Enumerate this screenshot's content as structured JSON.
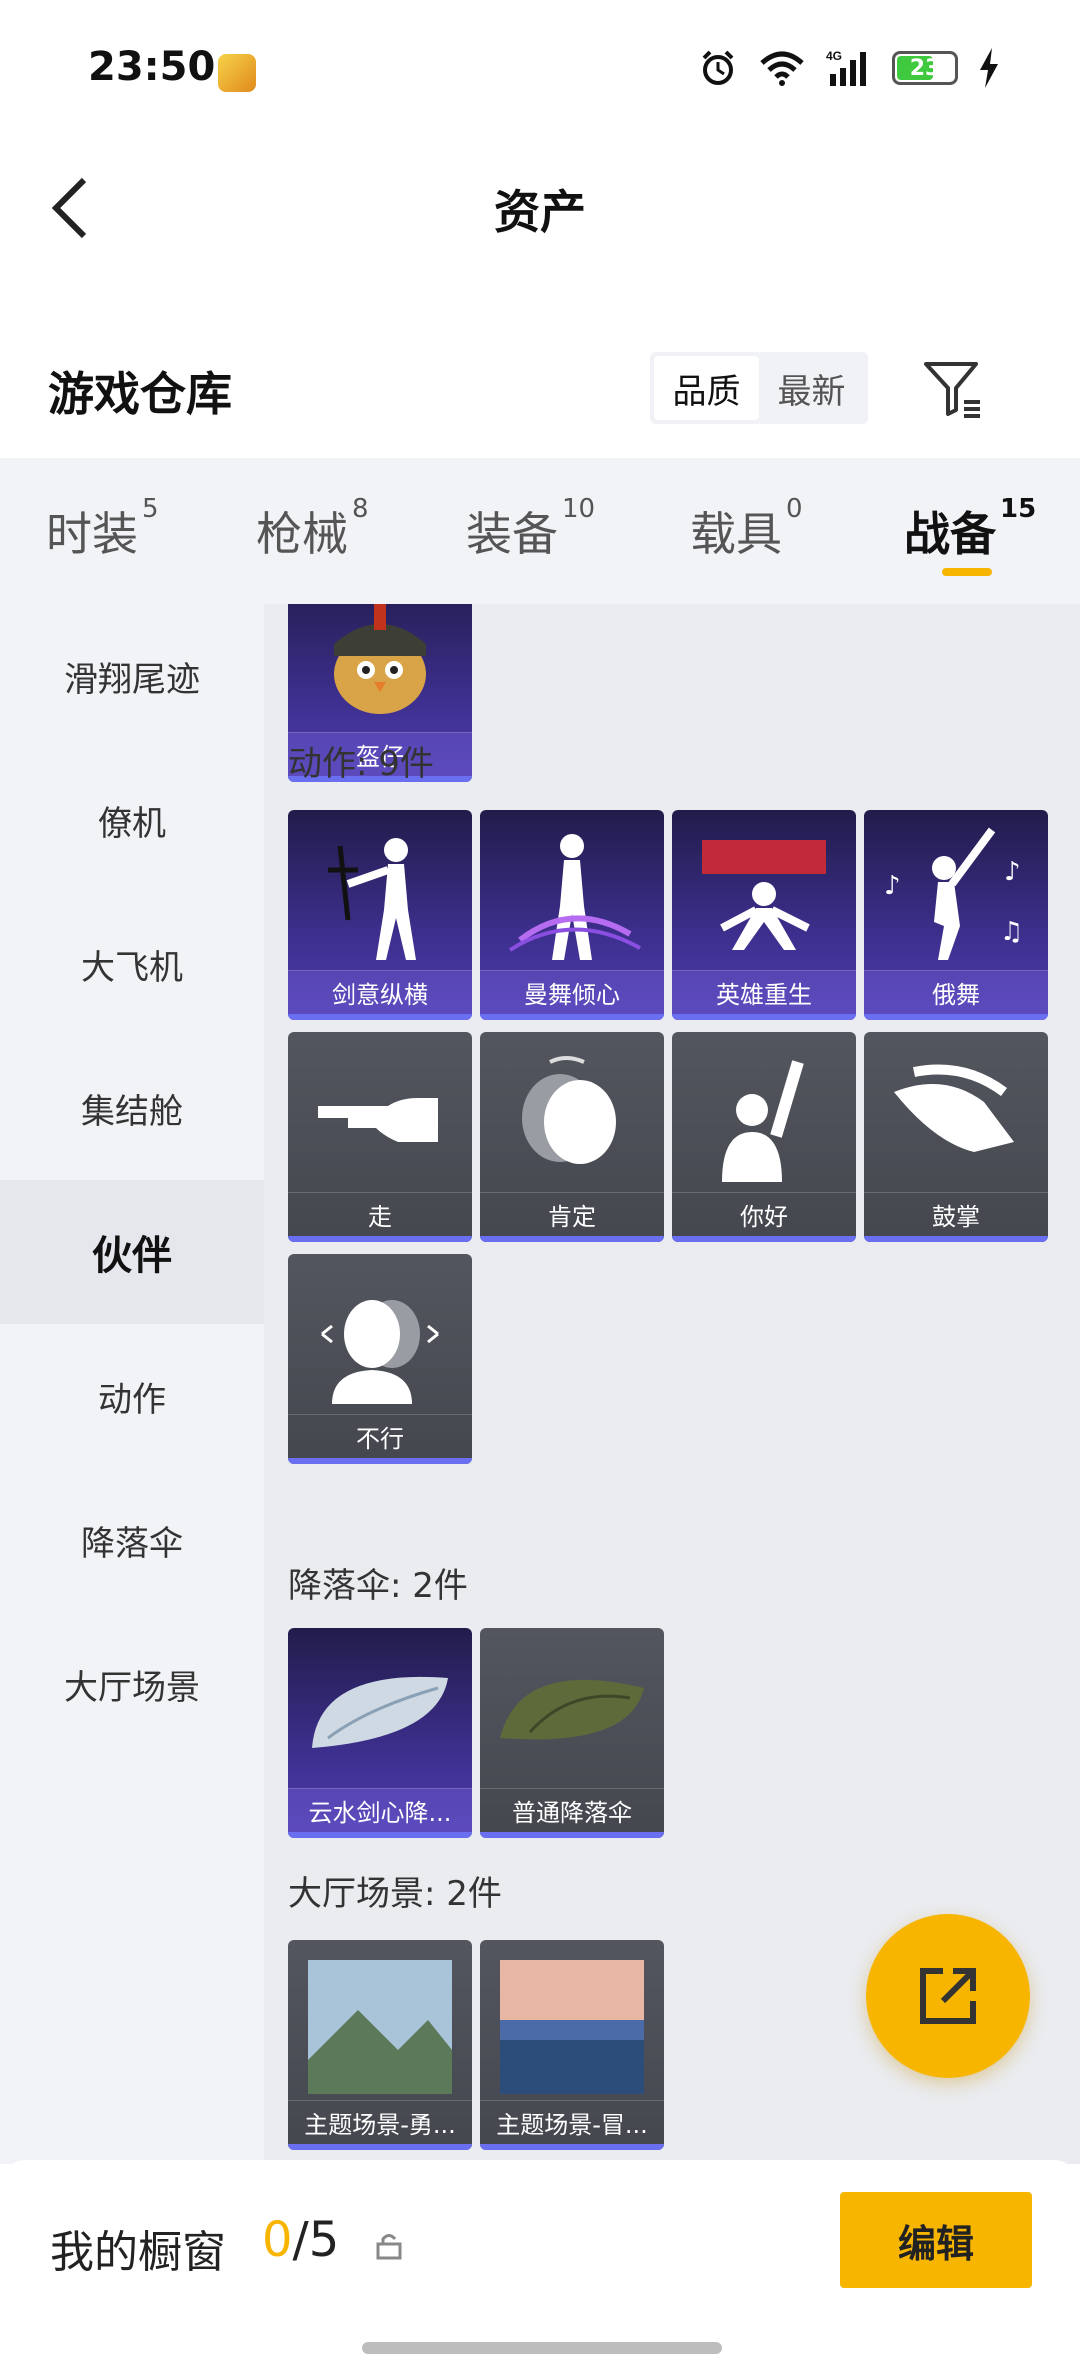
{
  "status_bar": {
    "time": "23:50",
    "battery": "23"
  },
  "header": {
    "title": "资产"
  },
  "warehouse": {
    "title": "游戏仓库",
    "sort_options": [
      {
        "label": "品质",
        "active": true
      },
      {
        "label": "最新",
        "active": false
      }
    ]
  },
  "tabs": [
    {
      "label": "时装",
      "count": "5"
    },
    {
      "label": "枪械",
      "count": "8"
    },
    {
      "label": "装备",
      "count": "10"
    },
    {
      "label": "载具",
      "count": "0"
    },
    {
      "label": "战备",
      "count": "15",
      "active": true
    }
  ],
  "sidebar": {
    "items": [
      {
        "label": "滑翔尾迹"
      },
      {
        "label": "僚机"
      },
      {
        "label": "大飞机"
      },
      {
        "label": "集结舱"
      },
      {
        "label": "伙伴",
        "active": true
      },
      {
        "label": "动作"
      },
      {
        "label": "降落伞"
      },
      {
        "label": "大厅场景"
      }
    ]
  },
  "content": {
    "partner_item": {
      "name": "盔仔"
    },
    "emote_section": {
      "title": "动作: 9件",
      "items": [
        {
          "name": "剑意纵横",
          "rarity": "purple"
        },
        {
          "name": "曼舞倾心",
          "rarity": "purple"
        },
        {
          "name": "英雄重生",
          "rarity": "purple"
        },
        {
          "name": "俄舞",
          "rarity": "purple"
        },
        {
          "name": "走",
          "rarity": "gray"
        },
        {
          "name": "肯定",
          "rarity": "gray"
        },
        {
          "name": "你好",
          "rarity": "gray"
        },
        {
          "name": "鼓掌",
          "rarity": "gray"
        },
        {
          "name": "不行",
          "rarity": "gray"
        }
      ]
    },
    "parachute_section": {
      "title": "降落伞: 2件",
      "items": [
        {
          "name": "云水剑心降...",
          "rarity": "purple"
        },
        {
          "name": "普通降落伞",
          "rarity": "gray"
        }
      ]
    },
    "lobby_section": {
      "title": "大厅场景: 2件",
      "items": [
        {
          "name": "主题场景-勇...",
          "rarity": "gray"
        },
        {
          "name": "主题场景-冒...",
          "rarity": "gray"
        }
      ]
    }
  },
  "bottom_bar": {
    "showcase_label": "我的橱窗",
    "showcase_current": "0",
    "showcase_total": "/5",
    "edit_label": "编辑"
  },
  "colors": {
    "accent": "#f7b500",
    "purple_card": "#3d2f8e",
    "gray_card": "#4b4d55",
    "rarity_bar": "#6a6ef0"
  }
}
